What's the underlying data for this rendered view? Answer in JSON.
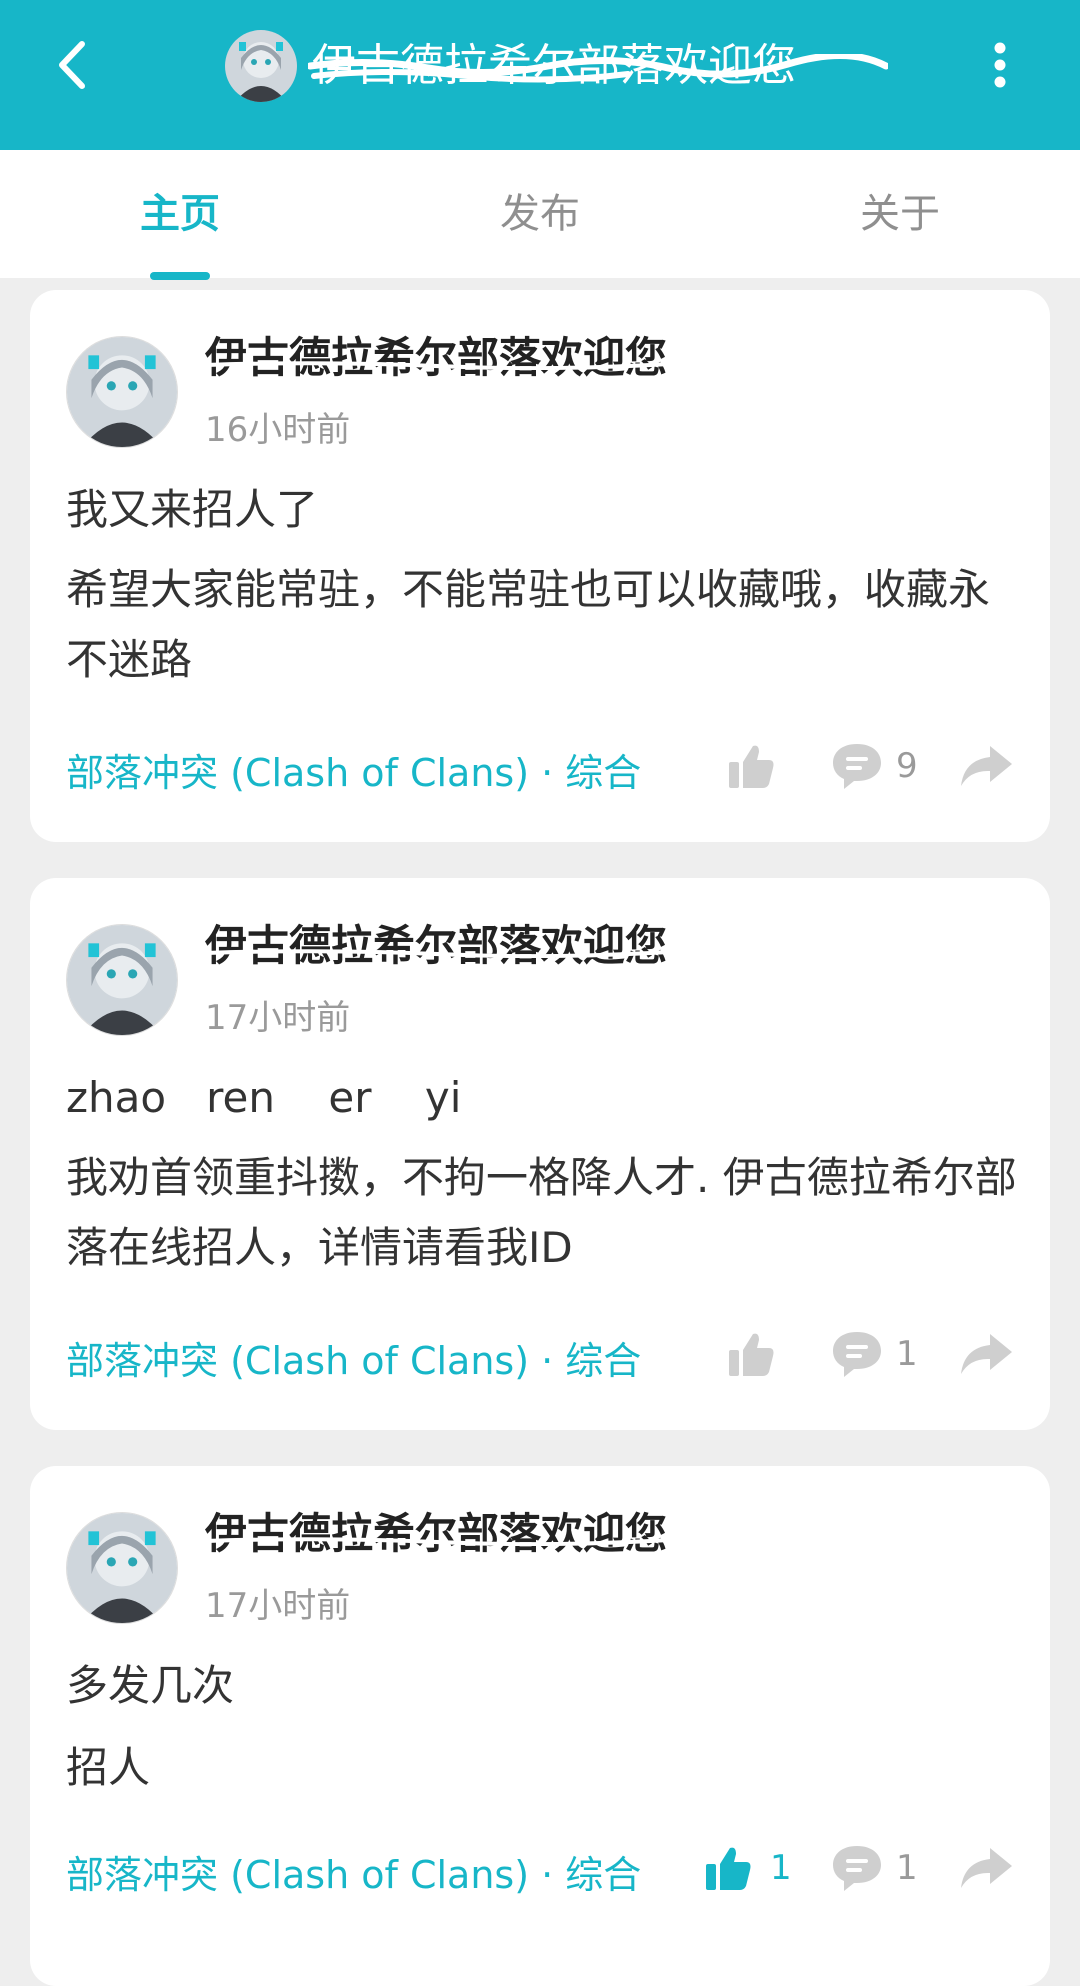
{
  "header": {
    "title": "伊古德拉希尔部落欢迎您",
    "back_icon": "chevron-left-icon",
    "more_icon": "more-vertical-icon",
    "color": "#17b6c8"
  },
  "tabs": [
    {
      "label": "主页",
      "active": true
    },
    {
      "label": "发布",
      "active": false
    },
    {
      "label": "关于",
      "active": false
    }
  ],
  "posts": [
    {
      "author": "伊古德拉希尔部落欢迎您",
      "time": "16小时前",
      "title": "我又来招人了",
      "body": "希望大家能常驻，不能常驻也可以收藏哦，收藏永不迷路",
      "tag": "部落冲突 (Clash of Clans) · 综合",
      "likes": "",
      "comments": "9",
      "liked": false
    },
    {
      "author": "伊古德拉希尔部落欢迎您",
      "time": "17小时前",
      "title": "zhao   ren    er    yi",
      "body": "我劝首领重抖擞，不拘一格降人才. 伊古德拉希尔部落在线招人，详情请看我ID",
      "tag": "部落冲突 (Clash of Clans) · 综合",
      "likes": "",
      "comments": "1",
      "liked": false
    },
    {
      "author": "伊古德拉希尔部落欢迎您",
      "time": "17小时前",
      "title": "多发几次",
      "body": "招人",
      "tag": "部落冲突 (Clash of Clans) · 综合",
      "likes": "1",
      "comments": "1",
      "liked": true
    }
  ]
}
